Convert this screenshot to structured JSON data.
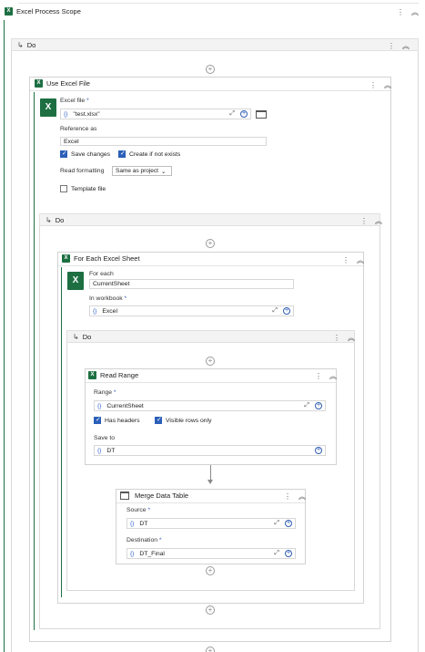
{
  "scope": {
    "title": "Excel Process Scope"
  },
  "outer_do": {
    "label": "Do"
  },
  "use_excel": {
    "title": "Use Excel File",
    "file_label": "Excel file",
    "file_value": "\"test.xlsx\"",
    "reference_label": "Reference as",
    "reference_value": "Excel",
    "save_changes": "Save changes",
    "create_if_not_exists": "Create if not exists",
    "read_formatting_label": "Read formatting",
    "read_formatting_value": "Same as project",
    "template_file": "Template file"
  },
  "inner_do": {
    "label": "Do"
  },
  "for_each": {
    "title": "For Each Excel Sheet",
    "for_each_label": "For each",
    "for_each_value": "CurrentSheet",
    "workbook_label": "In workbook",
    "workbook_value": "Excel"
  },
  "sheet_do": {
    "label": "Do"
  },
  "read_range": {
    "title": "Read Range",
    "range_label": "Range",
    "range_value": "CurrentSheet",
    "has_headers": "Has headers",
    "visible_rows": "Visible rows only",
    "save_to_label": "Save to",
    "save_to_value": "DT"
  },
  "merge": {
    "title": "Merge Data Table",
    "source_label": "Source",
    "source_value": "DT",
    "destination_label": "Destination",
    "destination_value": "DT_Final"
  },
  "common": {
    "required_mark": "*",
    "brace": "{}"
  },
  "colors": {
    "excel_green": "#1d6f42",
    "accent_blue": "#2b5fb8"
  }
}
